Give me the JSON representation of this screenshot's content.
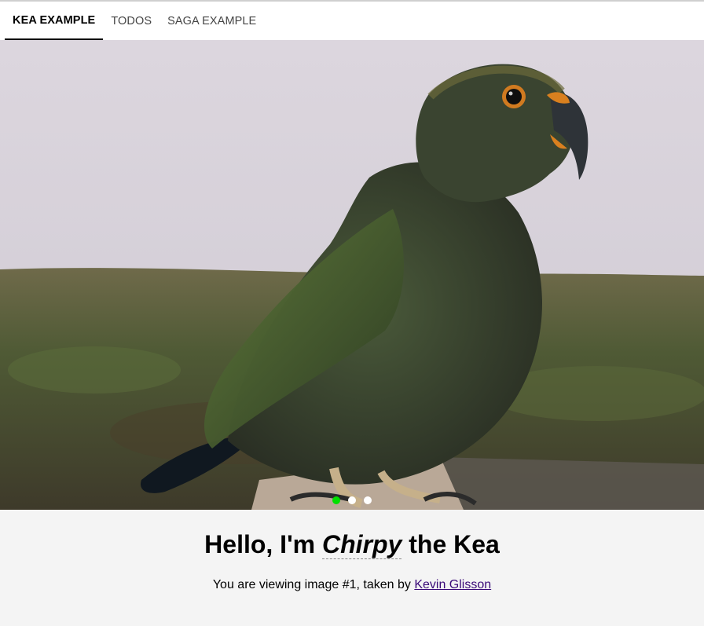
{
  "nav": {
    "tabs": [
      {
        "label": "KEA EXAMPLE",
        "active": true
      },
      {
        "label": "TODOS",
        "active": false
      },
      {
        "label": "SAGA EXAMPLE",
        "active": false
      }
    ]
  },
  "slideshow": {
    "image_icon": "kea-parrot-photo",
    "dots": [
      {
        "active": true
      },
      {
        "active": false
      },
      {
        "active": false
      }
    ],
    "active_color": "#00e000"
  },
  "caption": {
    "title_prefix": "Hello, I'm ",
    "title_name": "Chirpy",
    "title_suffix": " the Kea",
    "subtitle_prefix": "You are viewing image #",
    "image_number": "1",
    "subtitle_middle": ", taken by ",
    "photographer": "Kevin Glisson"
  }
}
